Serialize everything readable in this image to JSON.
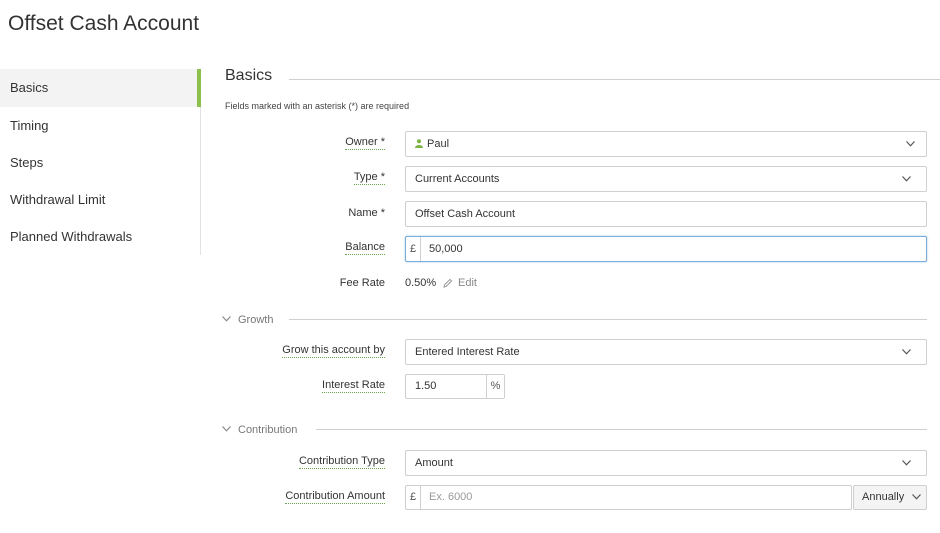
{
  "page": {
    "title": "Offset Cash Account"
  },
  "sidebar": {
    "items": [
      {
        "label": "Basics"
      },
      {
        "label": "Timing"
      },
      {
        "label": "Steps"
      },
      {
        "label": "Withdrawal Limit"
      },
      {
        "label": "Planned Withdrawals"
      }
    ]
  },
  "basics": {
    "title": "Basics",
    "required_note": "Fields marked with an asterisk (*) are required",
    "owner": {
      "label": "Owner *",
      "value": "Paul",
      "icon": "person-icon"
    },
    "type": {
      "label": "Type *",
      "value": "Current Accounts"
    },
    "name": {
      "label": "Name *",
      "value": "Offset Cash Account"
    },
    "balance": {
      "label": "Balance",
      "prefix": "£",
      "value": "50,000"
    },
    "fee_rate": {
      "label": "Fee Rate",
      "value": "0.50%",
      "edit_label": "Edit",
      "icon": "pencil-icon"
    }
  },
  "growth": {
    "title": "Growth",
    "grow_by": {
      "label": "Grow this account by",
      "value": "Entered Interest Rate"
    },
    "interest_rate": {
      "label": "Interest Rate",
      "value": "1.50",
      "suffix": "%"
    }
  },
  "contribution": {
    "title": "Contribution",
    "type": {
      "label": "Contribution Type",
      "value": "Amount"
    },
    "amount": {
      "label": "Contribution Amount",
      "prefix": "£",
      "placeholder": "Ex. 6000",
      "frequency": "Annually"
    }
  },
  "colors": {
    "accent": "#8cc04b",
    "focus_border": "#7aaed8",
    "icon_green": "#7cb342"
  }
}
